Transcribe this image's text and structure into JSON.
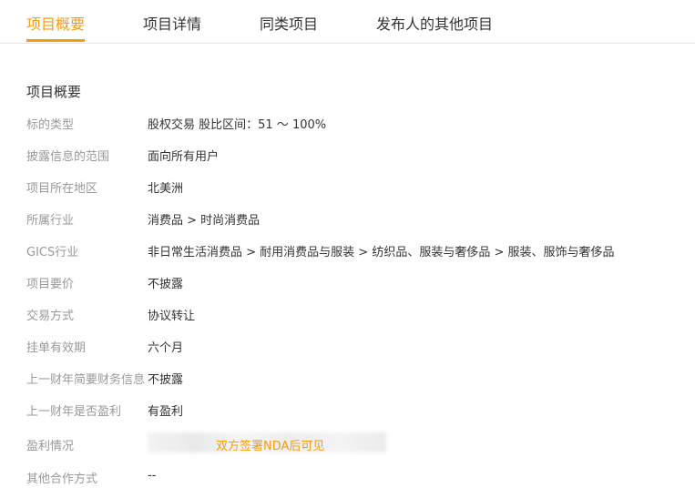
{
  "tabs": [
    {
      "label": "项目概要",
      "active": true
    },
    {
      "label": "项目详情",
      "active": false
    },
    {
      "label": "同类项目",
      "active": false
    },
    {
      "label": "发布人的其他项目",
      "active": false
    }
  ],
  "section_title": "项目概要",
  "rows": [
    {
      "label": "标的类型",
      "value": "股权交易 股比区间：51 ～ 100%"
    },
    {
      "label": "披露信息的范围",
      "value": "面向所有用户"
    },
    {
      "label": "项目所在地区",
      "value": "北美洲"
    },
    {
      "label": "所属行业",
      "value": "消费品 > 时尚消费品"
    },
    {
      "label": "GICS行业",
      "value": "非日常生活消费品 > 耐用消费品与服装 > 纺织品、服装与奢侈品 > 服装、服饰与奢侈品"
    },
    {
      "label": "项目要价",
      "value": "不披露"
    },
    {
      "label": "交易方式",
      "value": "协议转让"
    },
    {
      "label": "挂单有效期",
      "value": "六个月"
    },
    {
      "label": "上一财年简要财务信息",
      "value": "不披露"
    },
    {
      "label": "上一财年是否盈利",
      "value": "有盈利"
    },
    {
      "label": "盈利情况",
      "value": "双方签署NDA后可见"
    },
    {
      "label": "其他合作方式",
      "value": "--"
    }
  ],
  "colors": {
    "accent": "#f39c12",
    "label": "#999999",
    "text": "#333333"
  }
}
